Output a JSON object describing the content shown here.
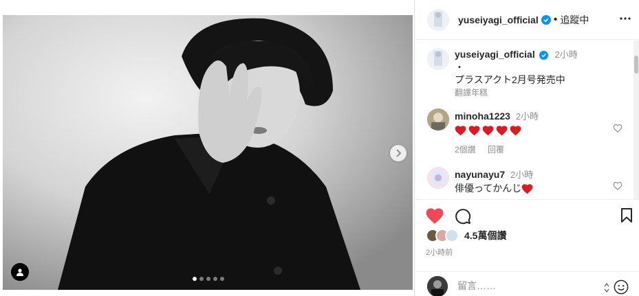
{
  "post": {
    "username": "yuseiyagi_official",
    "follow_state": "追蹤中",
    "caption_line1": "・",
    "caption_line2": "プラスアクト2月号発売中",
    "caption_time": "2小時",
    "translate_label": "翻譯年糕",
    "slide_count": 5,
    "active_slide": 1
  },
  "comments": [
    {
      "username": "minoha1223",
      "time": "2小時",
      "text": "",
      "hearts": 5,
      "likes_label": "2個讚",
      "reply_label": "回覆"
    },
    {
      "username": "nayunayu7",
      "time": "2小時",
      "text": "俳優ってかんじ",
      "hearts": 1
    }
  ],
  "stats": {
    "likes": "4.5萬個讚",
    "posted": "2小時前"
  },
  "composer": {
    "placeholder": "留言……"
  },
  "colors": {
    "liked_heart": "#ed4956",
    "verified": "#0095f6",
    "muted_text": "#8e8e8e"
  },
  "icons": {
    "more": "more-icon",
    "like": "heart-icon",
    "comment": "comment-icon",
    "save": "bookmark-icon",
    "next": "chevron-right-icon",
    "tag": "user-tag-icon",
    "emoji": "emoji-icon"
  }
}
